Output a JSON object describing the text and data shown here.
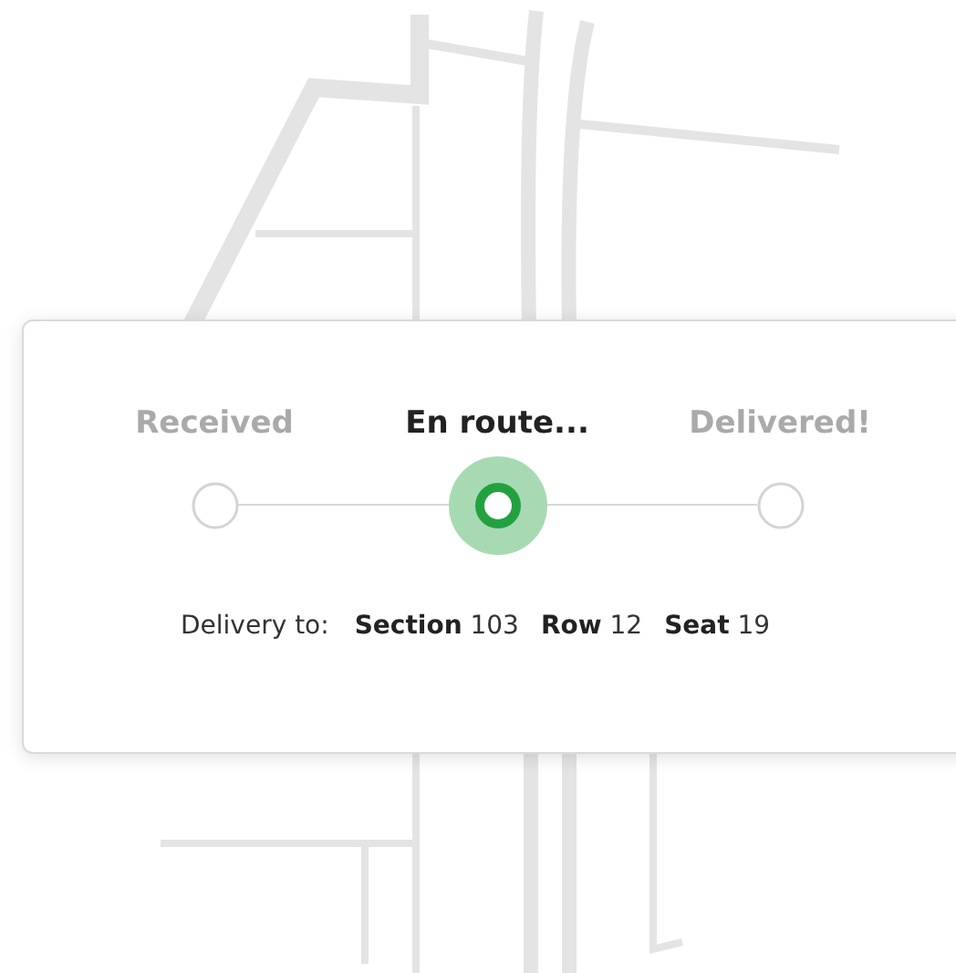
{
  "steps": [
    {
      "label": "Received",
      "selected": false
    },
    {
      "label": "En route...",
      "selected": true
    },
    {
      "label": "Delivered!",
      "selected": false
    }
  ],
  "delivery": {
    "label": "Delivery to:",
    "fields": [
      "**Section** 103",
      "**Row** 12",
      "**Seat** 19"
    ]
  }
}
